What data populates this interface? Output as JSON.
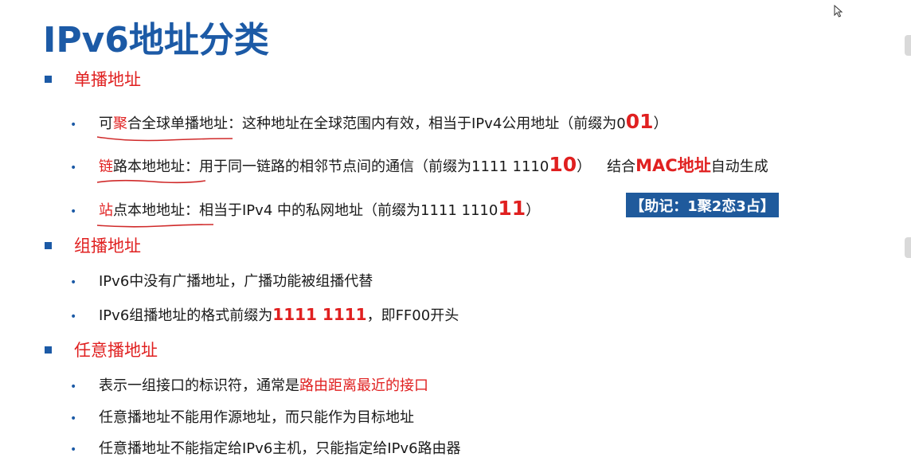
{
  "title": "IPv6地址分类",
  "sections": {
    "unicast": {
      "label": "单播地址",
      "items": {
        "global": {
          "pre": "可",
          "red_char": "聚",
          "term_rest": "合全球单播地址",
          "text": "：这种地址在全球范围内有效，相当于IPv4公用地址（前缀为0",
          "big": "01",
          "close": "）"
        },
        "link": {
          "red_char": "链",
          "term_rest": "路本地地址",
          "text": "：用于同一链路的相邻节点间的通信（前缀为1111 1110 ",
          "big": "10",
          "close": "）",
          "combine": "结合",
          "mac": "MAC地址",
          "auto": "自动生成"
        },
        "site": {
          "red_char": "站",
          "term_rest": "点本地地址",
          "text": "：相当于IPv4 中的私网地址（前缀为1111 1110 ",
          "big": "11",
          "close": "）"
        }
      },
      "mnemonic": "【助记：1聚2恋3占】"
    },
    "multicast": {
      "label": "组播地址",
      "item1": "IPv6中没有广播地址，广播功能被组播代替",
      "item2_pre": "IPv6组播地址的格式前缀为 ",
      "item2_bold": "1111 1111",
      "item2_post": "，即FF00开头"
    },
    "anycast": {
      "label": "任意播地址",
      "item1_pre": "表示一组接口的标识符，通常是",
      "item1_red": "路由距离最近的接口",
      "item2": "任意播地址不能用作源地址，而只能作为目标地址",
      "item3": "任意播地址不能指定给IPv6主机，只能指定给IPv6路由器"
    }
  },
  "colors": {
    "title_blue": "#1c5aa6",
    "accent_red": "#e02020",
    "mnemonic_bg": "#1f5a9c"
  },
  "icons": {
    "bullet_section": "square",
    "bullet_item": "dot",
    "cursor": "mouse-pointer-icon"
  }
}
